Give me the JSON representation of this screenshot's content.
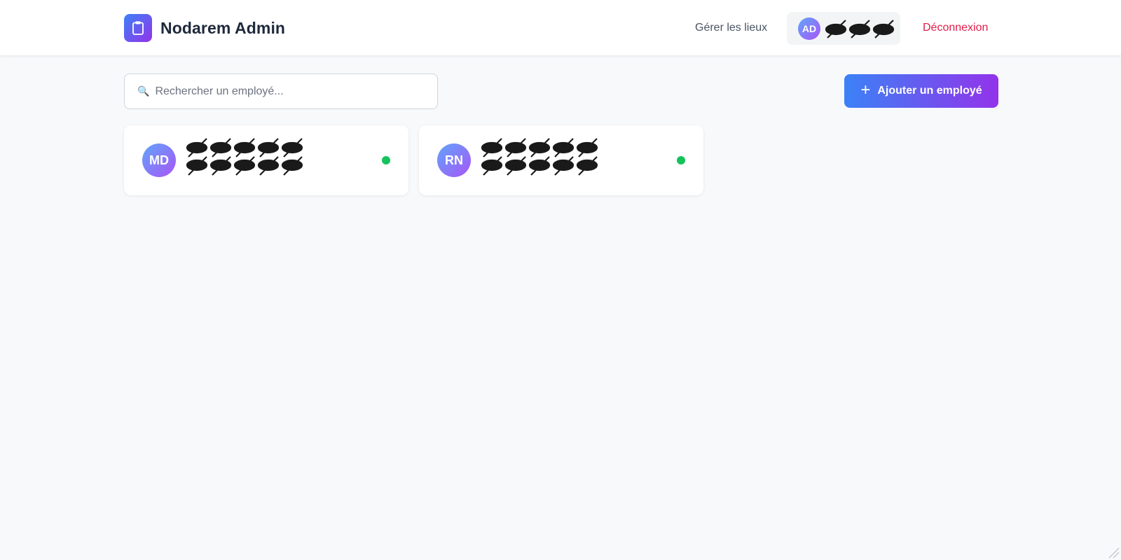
{
  "header": {
    "title": "Nodarem Admin",
    "logo_icon": "clipboard-icon",
    "nav_lieux": "Gérer les lieux",
    "user": {
      "initials": "AD",
      "name": ""
    },
    "logout": "Déconnexion"
  },
  "toolbar": {
    "search_placeholder": "Rechercher un employé...",
    "search_icon": "🔍",
    "add_button_plus": "+",
    "add_button_label": "Ajouter un employé"
  },
  "employees": [
    {
      "initials": "MD",
      "name": "",
      "email": "",
      "status": "active"
    },
    {
      "initials": "RN",
      "name": "",
      "email": "",
      "status": "active"
    }
  ],
  "colors": {
    "accent_start": "#3b82f6",
    "accent_end": "#9333ea",
    "logout": "#e11d48",
    "status_active": "#16c25a"
  }
}
